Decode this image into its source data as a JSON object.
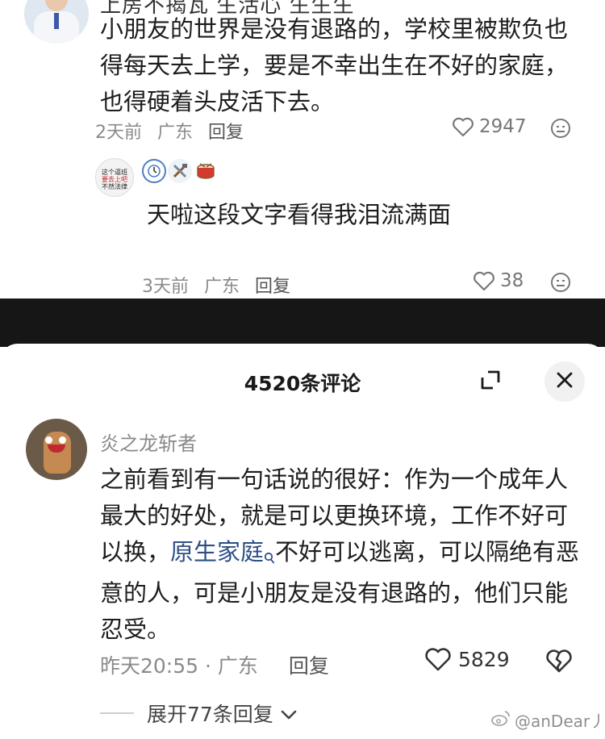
{
  "top_section": {
    "cut_header": "上房不揭瓦 生活心 生生生",
    "comment_text": "小朋友的世界是没有退路的，学校里被欺负也得每天去上学，要是不幸出生在不好的家庭，也得硬着头皮活下去。",
    "time": "2天前",
    "location": "广东",
    "reply_label": "回复",
    "likes": "2947"
  },
  "sub_reply": {
    "avatar_text_line1": "这个逼班",
    "avatar_text_line2": "要去上吧",
    "avatar_text_line3": "不然法律",
    "badges": [
      "clock-badge",
      "tools-badge",
      "drum-badge"
    ],
    "text": "天啦这段文字看得我泪流满面",
    "time": "3天前",
    "location": "广东",
    "reply_label": "回复",
    "likes": "38"
  },
  "sheet": {
    "title": "4520条评论",
    "comment": {
      "user_name": "炎之龙斩者",
      "text_before_link": "之前看到有一句话说的很好：作为一个成年人最大的好处，就是可以更换环境，工作不好可以换，",
      "link_text": "原生家庭",
      "text_after_link": "不好可以逃离，可以隔绝有恶意的人，可是小朋友是没有退路的，他们只能忍受。",
      "time": "昨天20:55",
      "separator": "·",
      "location": "广东",
      "reply_label": "回复",
      "likes": "5829"
    },
    "expand_replies_label": "展开77条回复"
  },
  "watermark": "@anDear丿",
  "colors": {
    "link": "#2e4f86",
    "meta_gray": "#8a8a8a",
    "band": "#161616",
    "close_bg": "#f1f1f1"
  }
}
